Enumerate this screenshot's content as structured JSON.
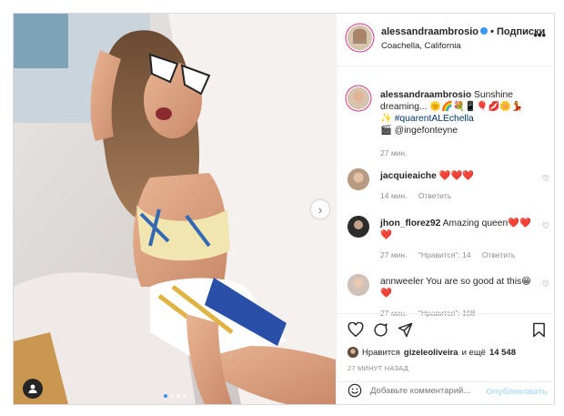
{
  "colors": {
    "accent": "#3897f0",
    "heart": "#e0213b",
    "muted": "#8e8e8e",
    "border": "#dbdbdb"
  },
  "post": {
    "carousel": {
      "slides": 4,
      "active_index": 0
    }
  },
  "header": {
    "username": "alessandraambrosio",
    "separator": "•",
    "follow_label": "Подписки",
    "location": "Coachella, California",
    "more_icon": "more-horizontal-icon"
  },
  "caption": {
    "username": "alessandraambrosio",
    "text": "Sunshine dreaming... 🌞🌈💐📱🎈💋🌼💃✨",
    "hashtag": "#quarentALEchella",
    "credit": "🎬 @ingefonteyne",
    "time": "27 мин."
  },
  "comments": [
    {
      "username": "jacquieaiche",
      "text": "❤️❤️❤️",
      "time": "14 мин.",
      "reply": "Ответить",
      "likes": ""
    },
    {
      "username": "jhon_florez92",
      "text": "Amazing queen❤️❤️❤️",
      "time": "27 мин.",
      "likes": "\"Нравится\": 14",
      "reply": "Ответить"
    },
    {
      "username": "annweeler",
      "text": "You are so good at this😁❤️",
      "time": "27 мин.",
      "likes": "\"Нравится\": 108",
      "reply": ""
    }
  ],
  "actions": {
    "like_icon": "heart-icon",
    "comment_icon": "comment-icon",
    "share_icon": "share-icon",
    "save_icon": "bookmark-icon"
  },
  "likes": {
    "prefix": "Нравится",
    "user": "gizeleoliveira",
    "middle": "и ещё",
    "count": "14 548"
  },
  "time_ago": "27 МИНУТ НАЗАД",
  "add_comment": {
    "placeholder": "Добавьте комментарий...",
    "publish_label": "Опубликовать"
  }
}
